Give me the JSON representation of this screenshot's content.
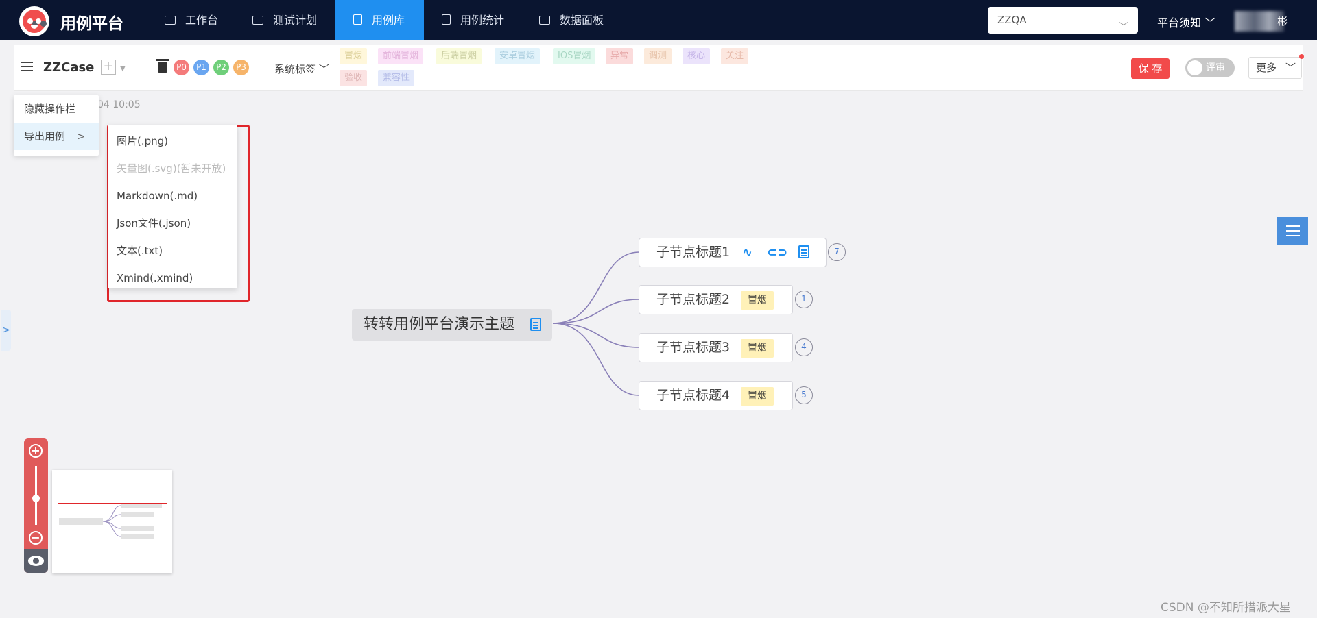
{
  "app": {
    "brand": "用例平台"
  },
  "nav": [
    {
      "label": "工作台",
      "active": false
    },
    {
      "label": "测试计划",
      "active": false
    },
    {
      "label": "用例库",
      "active": true
    },
    {
      "label": "用例统计",
      "active": false
    },
    {
      "label": "数据面板",
      "active": false
    }
  ],
  "header": {
    "project_select": "ZZQA",
    "notice": "平台须知",
    "user_name_suffix": "彬"
  },
  "toolbar": {
    "case_title": "ZZCase",
    "add": "+",
    "priorities": [
      "P0",
      "P1",
      "P2",
      "P3"
    ],
    "system_tags_label": "系统标签",
    "tags": [
      "冒烟",
      "前端冒烟",
      "后端冒烟",
      "安卓冒烟",
      "IOS冒烟",
      "异常",
      "调测",
      "核心",
      "关注",
      "验收",
      "兼容性"
    ],
    "save": "保 存",
    "review_toggle": "评审",
    "more": "更多"
  },
  "date_text": "04 10:05",
  "context_menu": {
    "items": [
      "隐藏操作栏",
      "导出用例"
    ],
    "highlighted": "导出用例"
  },
  "export_submenu": [
    {
      "label": "图片(.png)",
      "enabled": true
    },
    {
      "label": "矢量图(.svg)(暂未开放)",
      "enabled": false
    },
    {
      "label": "Markdown(.md)",
      "enabled": true
    },
    {
      "label": "Json文件(.json)",
      "enabled": true
    },
    {
      "label": "文本(.txt)",
      "enabled": true
    },
    {
      "label": "Xmind(.xmind)",
      "enabled": true
    }
  ],
  "mindmap": {
    "root": "转转用例平台演示主题",
    "children": [
      {
        "title": "子节点标题1",
        "tag": "",
        "count": "7"
      },
      {
        "title": "子节点标题2",
        "tag": "冒烟",
        "count": "1"
      },
      {
        "title": "子节点标题3",
        "tag": "冒烟",
        "count": "4"
      },
      {
        "title": "子节点标题4",
        "tag": "冒烟",
        "count": "5"
      }
    ]
  },
  "zoom": {
    "in": "+",
    "out": "−"
  },
  "watermark": "CSDN @不知所措派大星",
  "colors": {
    "nav_bg": "#0a1530",
    "accent": "#1f8ff0",
    "danger": "#f24a4a",
    "smoke_tag": "#fff1b8"
  }
}
